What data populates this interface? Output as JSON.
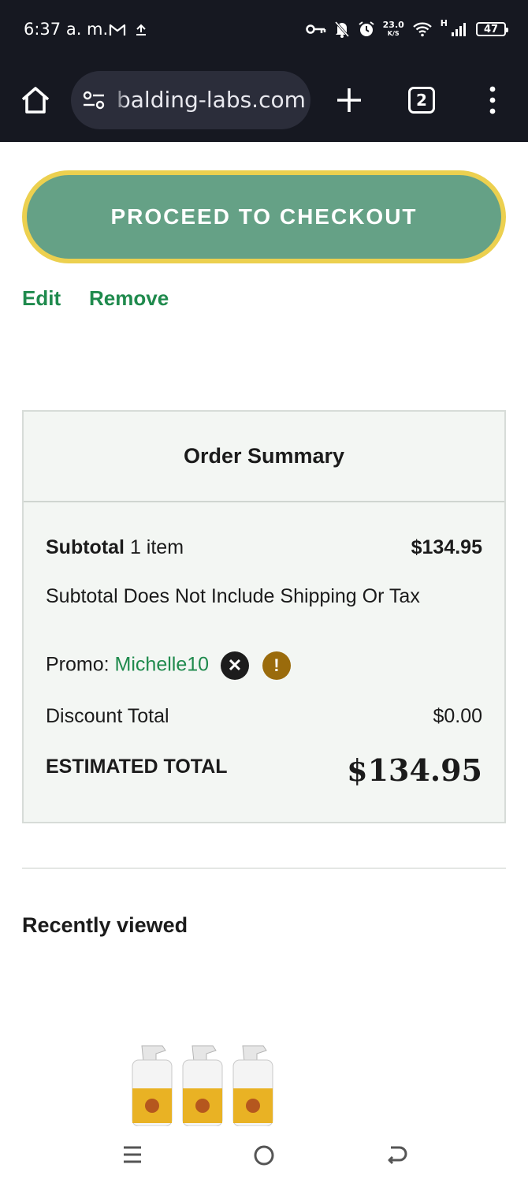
{
  "status_bar": {
    "time": "6:37 a. m.",
    "net_speed_value": "23.0",
    "net_speed_unit": "K/S",
    "network_type": "H",
    "battery": "47"
  },
  "browser": {
    "url": "balding-labs.com",
    "tab_count": "2"
  },
  "cart": {
    "checkout_label": "PROCEED TO CHECKOUT",
    "edit_label": "Edit",
    "remove_label": "Remove"
  },
  "summary": {
    "title": "Order Summary",
    "subtotal_label": "Subtotal",
    "subtotal_items": "1 item",
    "subtotal_value": "$134.95",
    "subtotal_note": "Subtotal Does Not Include Shipping Or Tax",
    "promo_label": "Promo:",
    "promo_code": "Michelle10",
    "discount_label": "Discount Total",
    "discount_value": "$0.00",
    "estimated_label": "ESTIMATED TOTAL",
    "estimated_value": "$134.95"
  },
  "recently_viewed": {
    "title": "Recently viewed"
  },
  "colors": {
    "checkout_fill": "#65a186",
    "checkout_border": "#ecd04f",
    "link_green": "#1f8a4d",
    "summary_bg": "#f3f6f3",
    "warning": "#9a6b0c"
  }
}
